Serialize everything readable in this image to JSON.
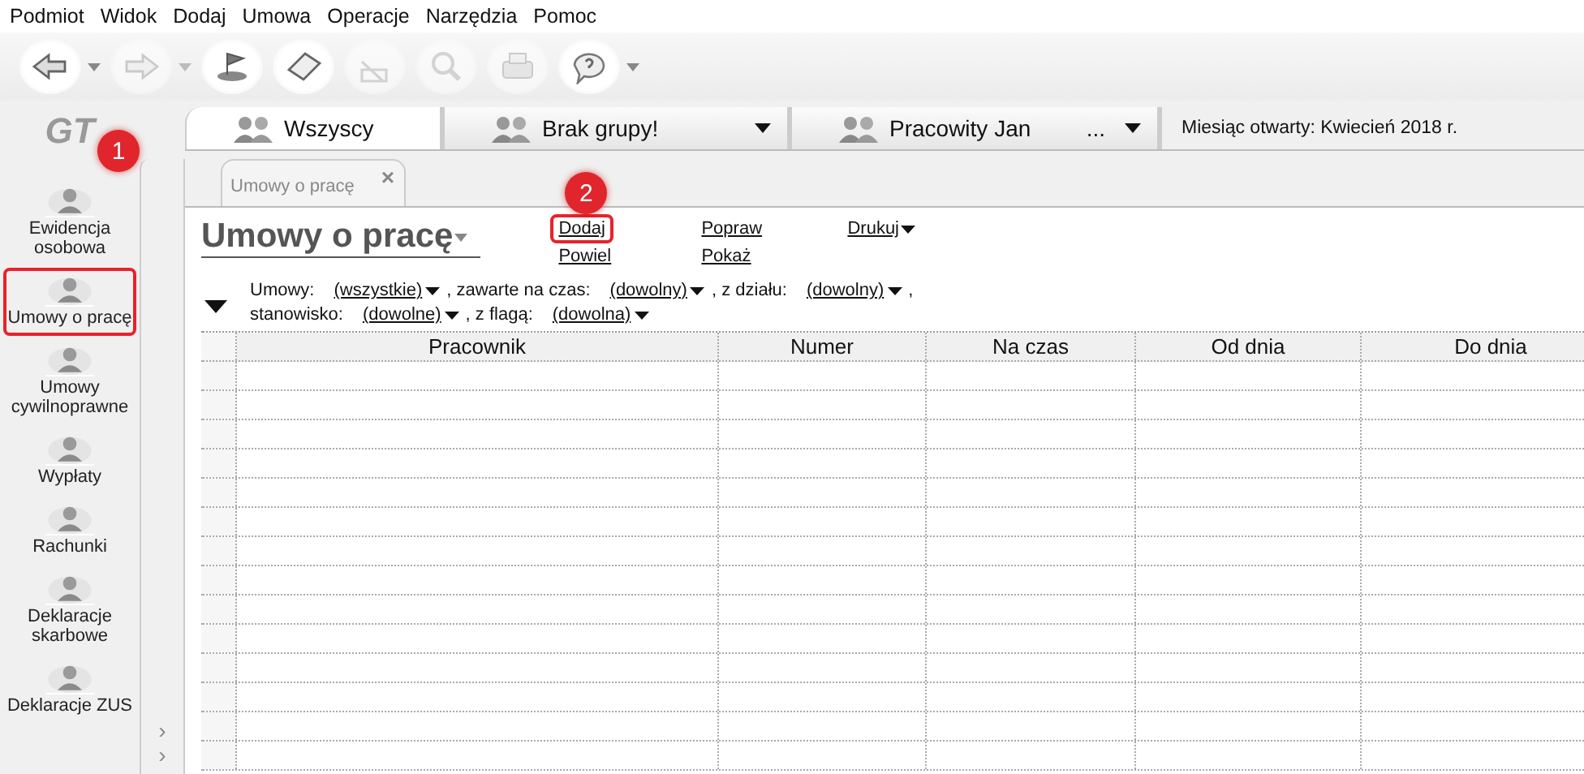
{
  "menu": [
    "Podmiot",
    "Widok",
    "Dodaj",
    "Umowa",
    "Operacje",
    "Narzędzia",
    "Pomoc"
  ],
  "toolbar": [
    {
      "disabled": false,
      "has_menu": true
    },
    {
      "disabled": true,
      "has_menu": true
    },
    {
      "disabled": false,
      "has_menu": false
    },
    {
      "disabled": false,
      "has_menu": false
    },
    {
      "disabled": true,
      "has_menu": false
    },
    {
      "disabled": true,
      "has_menu": false
    },
    {
      "disabled": true,
      "has_menu": false
    },
    {
      "disabled": false,
      "has_menu": true
    }
  ],
  "logo": "GT",
  "strip_arrows": [
    "›",
    "›"
  ],
  "sidebar": [
    {
      "label": "Ewidencja osobowa",
      "highlighted": false,
      "callout": "1"
    },
    {
      "label": "Umowy o pracę",
      "highlighted": true
    },
    {
      "label": "Umowy cywilnoprawne",
      "highlighted": false
    },
    {
      "label": "Wypłaty",
      "highlighted": false
    },
    {
      "label": "Rachunki",
      "highlighted": false
    },
    {
      "label": "Deklaracje skarbowe",
      "highlighted": false
    },
    {
      "label": "Deklaracje ZUS",
      "highlighted": false
    }
  ],
  "group_tabs": [
    {
      "label": "Wszyscy",
      "selected": true,
      "has_menu": false
    },
    {
      "label": "Brak grupy!",
      "selected": false,
      "has_menu": true
    },
    {
      "label": "Pracowity Jan",
      "selected": false,
      "has_menu": true,
      "more": "..."
    }
  ],
  "month_info": "Miesiąc otwarty:  Kwiecień 2018 r.",
  "doc_tab": {
    "label": "Umowy o pracę",
    "close": "×"
  },
  "title": "Umowy o pracę",
  "actions": [
    {
      "label": "Dodaj",
      "highlighted": true,
      "callout": "2",
      "has_menu": false
    },
    {
      "label": "Powiel",
      "highlighted": false,
      "has_menu": false
    },
    {
      "label": "Popraw",
      "highlighted": false,
      "has_menu": false
    },
    {
      "label": "Pokaż",
      "highlighted": false,
      "has_menu": false
    },
    {
      "label": "Drukuj",
      "highlighted": false,
      "has_menu": true
    }
  ],
  "filter_lines": [
    [
      {
        "label": "Umowy:",
        "value": "(wszystkie)"
      },
      {
        "label": ", zawarte na czas:",
        "value": "(dowolny)"
      },
      {
        "label": ", z działu:",
        "value": "(dowolny)"
      },
      {
        "label": ","
      }
    ],
    [
      {
        "label": "stanowisko:",
        "value": "(dowolne)"
      },
      {
        "label": ", z flagą:",
        "value": "(dowolna)"
      }
    ]
  ],
  "table": {
    "columns": [
      "Pracownik",
      "Numer",
      "Na czas",
      "Od dnia",
      "Do dnia"
    ]
  }
}
